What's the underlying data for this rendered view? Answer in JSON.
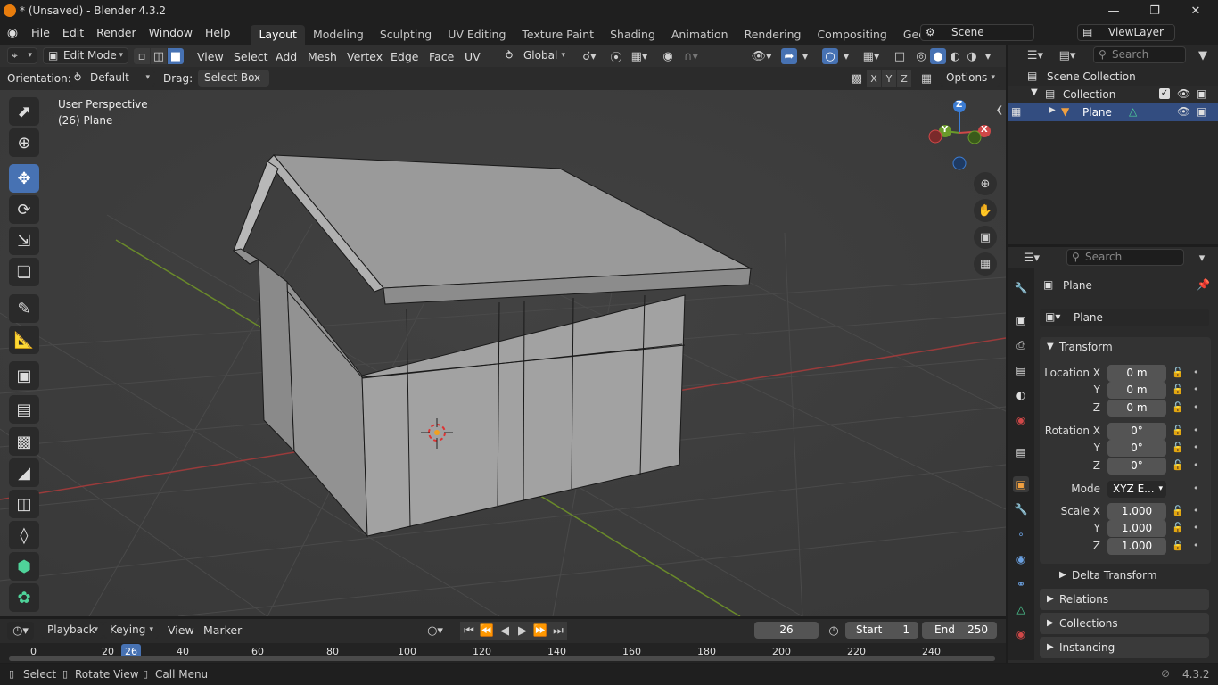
{
  "title": "* (Unsaved) - Blender 4.3.2",
  "menus": [
    "File",
    "Edit",
    "Render",
    "Window",
    "Help"
  ],
  "workspaces": [
    "Layout",
    "Modeling",
    "Sculpting",
    "UV Editing",
    "Texture Paint",
    "Shading",
    "Animation",
    "Rendering",
    "Compositing",
    "Geometry Node"
  ],
  "scene": "Scene",
  "view_layer": "ViewLayer",
  "viewport": {
    "mode": "Edit Mode",
    "header_menus": [
      "View",
      "Select",
      "Add",
      "Mesh",
      "Vertex",
      "Edge",
      "Face",
      "UV"
    ],
    "transform_orientation": "Global",
    "orientation_label": "Orientation:",
    "orientation_value": "Default",
    "drag_label": "Drag:",
    "drag_value": "Select Box",
    "axes": [
      "X",
      "Y",
      "Z"
    ],
    "options": "Options",
    "overlay_title": "User Perspective",
    "overlay_object": "(26) Plane",
    "gizmo": {
      "z": "Z",
      "y": "Y",
      "x": "X"
    }
  },
  "outliner": {
    "search_placeholder": "Search",
    "scene_collection": "Scene Collection",
    "collection": "Collection",
    "object": "Plane"
  },
  "properties": {
    "search_placeholder": "Search",
    "object_name": "Plane",
    "data_name": "Plane",
    "transform_header": "Transform",
    "location_label": "Location X",
    "rotation_label": "Rotation X",
    "scale_label": "Scale X",
    "y_label": "Y",
    "z_label": "Z",
    "location": [
      "0 m",
      "0 m",
      "0 m"
    ],
    "rotation": [
      "0°",
      "0°",
      "0°"
    ],
    "mode_label": "Mode",
    "mode_value": "XYZ E...",
    "scale": [
      "1.000",
      "1.000",
      "1.000"
    ],
    "delta_transform": "Delta Transform",
    "relations": "Relations",
    "collections": "Collections",
    "instancing": "Instancing"
  },
  "timeline": {
    "menus": [
      "Playback",
      "Keying",
      "View",
      "Marker"
    ],
    "current_frame": "26",
    "start_label": "Start",
    "start_value": "1",
    "end_label": "End",
    "end_value": "250",
    "ruler": [
      "0",
      "20",
      "26",
      "40",
      "60",
      "80",
      "100",
      "120",
      "140",
      "160",
      "180",
      "200",
      "220",
      "240"
    ]
  },
  "status": {
    "select": "Select",
    "rotate_view": "Rotate View",
    "call_menu": "Call Menu",
    "version": "4.3.2"
  },
  "colors": {
    "accent": "#4772b3",
    "viewport_bg": "#3d3d3d",
    "grid_red": "#9a3b3b",
    "grid_green": "#6a8a2a"
  }
}
